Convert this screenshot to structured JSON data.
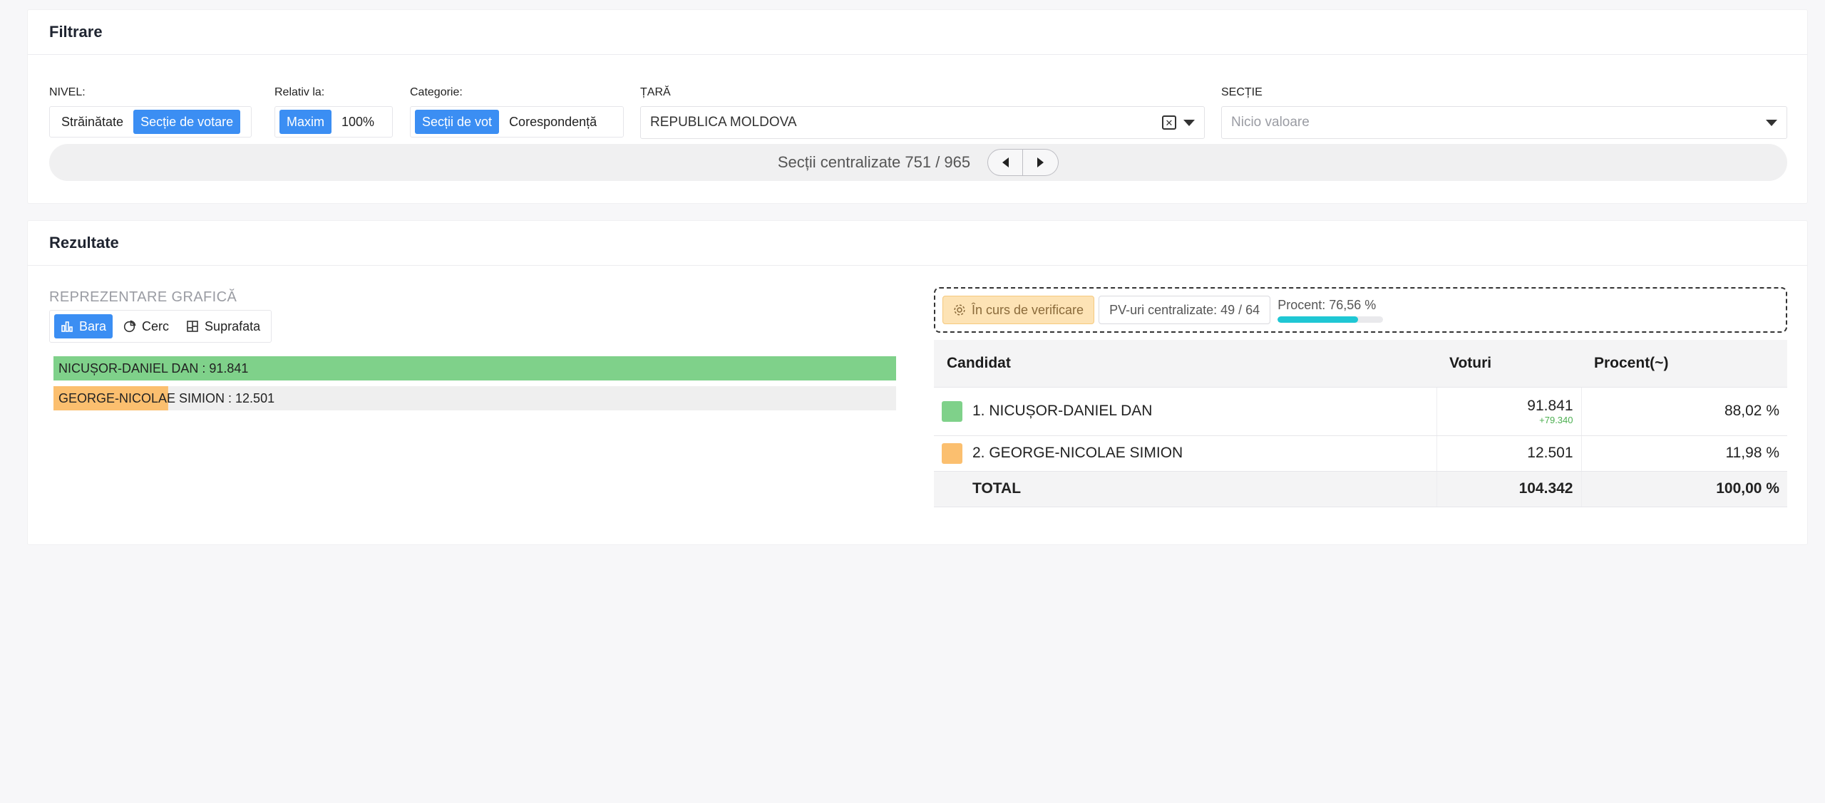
{
  "filter": {
    "title": "Filtrare",
    "nivel": {
      "label": "NIVEL:",
      "options": [
        "Străinătate",
        "Secție de votare"
      ],
      "active": 1
    },
    "relativ": {
      "label": "Relativ la:",
      "options": [
        "Maxim",
        "100%"
      ],
      "active": 0
    },
    "categorie": {
      "label": "Categorie:",
      "options": [
        "Secții de vot",
        "Corespondență"
      ],
      "active": 0
    },
    "tara": {
      "label": "ȚARĂ",
      "value": "REPUBLICA MOLDOVA"
    },
    "sectie": {
      "label": "SECȚIE",
      "placeholder": "Nicio valoare"
    },
    "centralizate": "Secții centralizate 751 / 965"
  },
  "results": {
    "title": "Rezultate",
    "chart_label": "REPREZENTARE GRAFICĂ",
    "chart_tabs": [
      "Bara",
      "Cerc",
      "Suprafata"
    ],
    "status": "În curs de verificare",
    "pv": "PV-uri centralizate: 49 / 64",
    "procent_label": "Procent: 76,56 %",
    "procent_value": 0.7656,
    "table": {
      "headers": [
        "Candidat",
        "Voturi",
        "Procent(~)"
      ],
      "rows": [
        {
          "name": "1. NICUȘOR-DANIEL DAN",
          "votes": "91.841",
          "diff": "+79.340",
          "percent": "88,02 %",
          "color": "#7fd18a"
        },
        {
          "name": "2. GEORGE-NICOLAE SIMION",
          "votes": "12.501",
          "diff": "",
          "percent": "11,98 %",
          "color": "#fbbf6f"
        }
      ],
      "total": {
        "name": "TOTAL",
        "votes": "104.342",
        "percent": "100,00 %"
      }
    }
  },
  "chart_data": {
    "type": "bar",
    "orientation": "horizontal",
    "categories": [
      "NICUȘOR-DANIEL DAN",
      "GEORGE-NICOLAE SIMION"
    ],
    "values": [
      91841,
      12501
    ],
    "labels": [
      "NICUȘOR-DANIEL DAN : 91.841",
      "GEORGE-NICOLAE SIMION : 12.501"
    ],
    "colors": [
      "#7fd18a",
      "#fbbf6f"
    ],
    "scale": "relative to maxim"
  }
}
